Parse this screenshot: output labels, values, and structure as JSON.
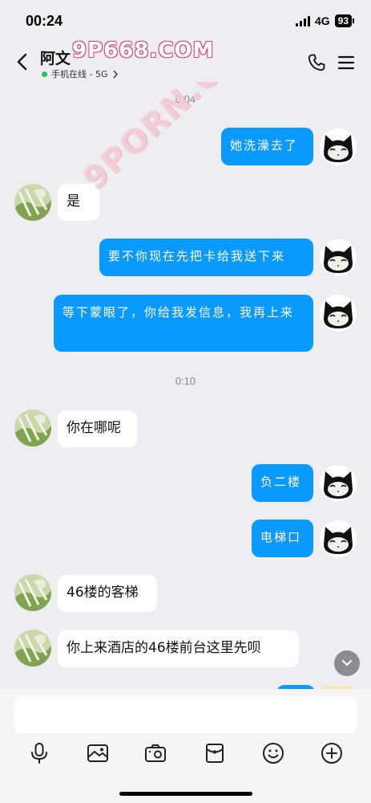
{
  "status_bar": {
    "time": "00:24",
    "network": "4G",
    "battery": "93"
  },
  "header": {
    "contact_name": "阿文",
    "watermark": "9P668.COM",
    "online_status": "手机在线 - 5G",
    "icons": {
      "back": "chevron-left-icon",
      "call": "phone-icon",
      "menu": "menu-icon"
    }
  },
  "watermark_diagonal": "9PORN.COM",
  "messages": [
    {
      "type": "timestamp",
      "text": "0:04"
    },
    {
      "type": "out",
      "text": "她洗澡去了"
    },
    {
      "type": "in",
      "text": "是"
    },
    {
      "type": "out",
      "text": "要不你现在先把卡给我送下来"
    },
    {
      "type": "out",
      "text": "等下蒙眼了，你给我发信息，我再上来"
    },
    {
      "type": "timestamp",
      "text": "0:10"
    },
    {
      "type": "in",
      "text": "你在哪呢"
    },
    {
      "type": "out",
      "text": "负二楼"
    },
    {
      "type": "out",
      "text": "电梯口"
    },
    {
      "type": "in",
      "text": "46楼的客梯"
    },
    {
      "type": "in",
      "text": "你上来酒店的46楼前台这里先呗"
    }
  ],
  "toolbar": {
    "icons": [
      "microphone-icon",
      "image-icon",
      "camera-icon",
      "red-packet-icon",
      "emoji-icon",
      "plus-icon"
    ]
  },
  "colors": {
    "accent": "#0a99ff",
    "background": "#ededf2",
    "online": "#2ac062"
  }
}
